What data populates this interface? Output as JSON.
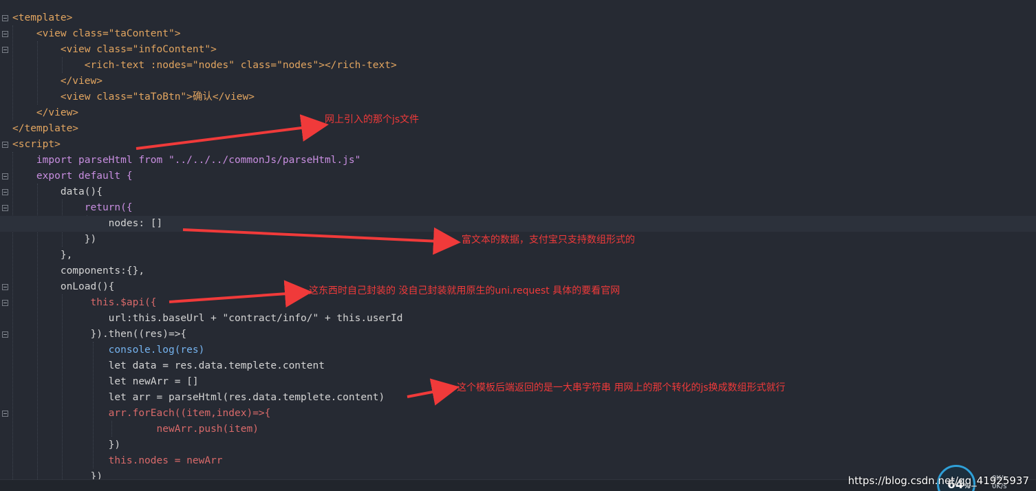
{
  "code": {
    "lines": [
      "<template>",
      "    <view class=\"taContent\">",
      "        <view class=\"infoContent\">",
      "            <rich-text :nodes=\"nodes\" class=\"nodes\"></rich-text>",
      "        </view>",
      "        <view class=\"taToBtn\">确认</view>",
      "    </view>",
      "</template>",
      "<script>",
      "    import parseHtml from \"../../../commonJs/parseHtml.js\"",
      "    export default {",
      "        data(){",
      "            return({",
      "                nodes: []",
      "            })",
      "        },",
      "        components:{},",
      "        onLoad(){",
      "             this.$api({",
      "                url:this.baseUrl + \"contract/info/\" + this.userId",
      "             }).then((res)=>{",
      "                console.log(res)",
      "                let data = res.data.templete.content",
      "                let newArr = []",
      "                let arr = parseHtml(res.data.templete.content)",
      "                arr.forEach((item,index)=>{",
      "                        newArr.push(item)",
      "                })",
      "                this.nodes = newArr",
      "             })"
    ]
  },
  "annotations": {
    "a1": "网上引入的那个js文件",
    "a2": "富文本的数据，支付宝只支持数组形式的",
    "a3": "这东西时自己封装的   没自己封装就用原生的uni.request   具体的要看官网",
    "a4": "这个模板后端返回的是一大串字符串   用网上的那个转化的js换成数组形式就行"
  },
  "overlay": {
    "watermark": "https://blog.csdn.net/qq_41925937",
    "gauge_value": "64",
    "gauge_unit": "%",
    "rate_up": "0K/s",
    "rate_down": "0K/s"
  },
  "colors": {
    "background": "#262a33",
    "annotation": "#f03a3a",
    "tag": "#e2a560",
    "attribute": "#8fc1e8",
    "string": "#e8d8a5",
    "keyword": "#c88ee0"
  }
}
